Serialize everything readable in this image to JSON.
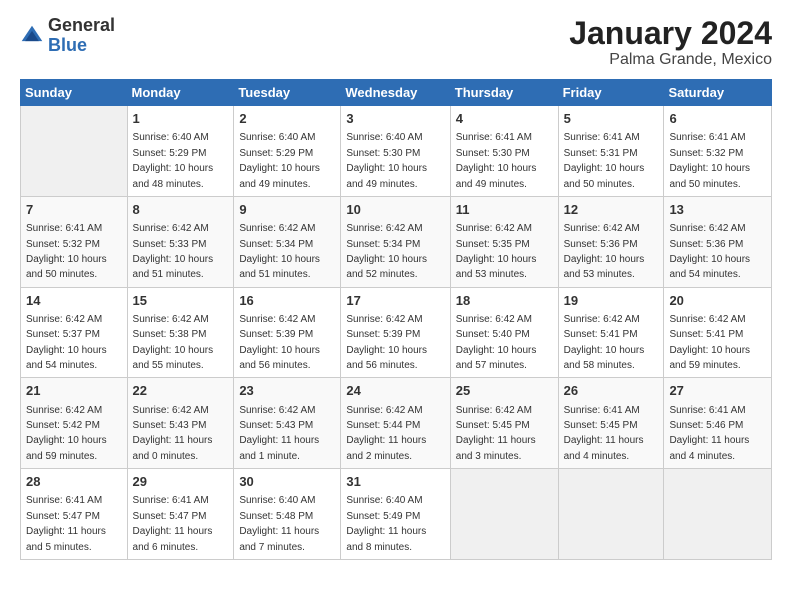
{
  "logo": {
    "general": "General",
    "blue": "Blue"
  },
  "header": {
    "month": "January 2024",
    "location": "Palma Grande, Mexico"
  },
  "columns": [
    "Sunday",
    "Monday",
    "Tuesday",
    "Wednesday",
    "Thursday",
    "Friday",
    "Saturday"
  ],
  "weeks": [
    [
      {
        "day": "",
        "info": ""
      },
      {
        "day": "1",
        "info": "Sunrise: 6:40 AM\nSunset: 5:29 PM\nDaylight: 10 hours\nand 48 minutes."
      },
      {
        "day": "2",
        "info": "Sunrise: 6:40 AM\nSunset: 5:29 PM\nDaylight: 10 hours\nand 49 minutes."
      },
      {
        "day": "3",
        "info": "Sunrise: 6:40 AM\nSunset: 5:30 PM\nDaylight: 10 hours\nand 49 minutes."
      },
      {
        "day": "4",
        "info": "Sunrise: 6:41 AM\nSunset: 5:30 PM\nDaylight: 10 hours\nand 49 minutes."
      },
      {
        "day": "5",
        "info": "Sunrise: 6:41 AM\nSunset: 5:31 PM\nDaylight: 10 hours\nand 50 minutes."
      },
      {
        "day": "6",
        "info": "Sunrise: 6:41 AM\nSunset: 5:32 PM\nDaylight: 10 hours\nand 50 minutes."
      }
    ],
    [
      {
        "day": "7",
        "info": "Sunrise: 6:41 AM\nSunset: 5:32 PM\nDaylight: 10 hours\nand 50 minutes."
      },
      {
        "day": "8",
        "info": "Sunrise: 6:42 AM\nSunset: 5:33 PM\nDaylight: 10 hours\nand 51 minutes."
      },
      {
        "day": "9",
        "info": "Sunrise: 6:42 AM\nSunset: 5:34 PM\nDaylight: 10 hours\nand 51 minutes."
      },
      {
        "day": "10",
        "info": "Sunrise: 6:42 AM\nSunset: 5:34 PM\nDaylight: 10 hours\nand 52 minutes."
      },
      {
        "day": "11",
        "info": "Sunrise: 6:42 AM\nSunset: 5:35 PM\nDaylight: 10 hours\nand 53 minutes."
      },
      {
        "day": "12",
        "info": "Sunrise: 6:42 AM\nSunset: 5:36 PM\nDaylight: 10 hours\nand 53 minutes."
      },
      {
        "day": "13",
        "info": "Sunrise: 6:42 AM\nSunset: 5:36 PM\nDaylight: 10 hours\nand 54 minutes."
      }
    ],
    [
      {
        "day": "14",
        "info": "Sunrise: 6:42 AM\nSunset: 5:37 PM\nDaylight: 10 hours\nand 54 minutes."
      },
      {
        "day": "15",
        "info": "Sunrise: 6:42 AM\nSunset: 5:38 PM\nDaylight: 10 hours\nand 55 minutes."
      },
      {
        "day": "16",
        "info": "Sunrise: 6:42 AM\nSunset: 5:39 PM\nDaylight: 10 hours\nand 56 minutes."
      },
      {
        "day": "17",
        "info": "Sunrise: 6:42 AM\nSunset: 5:39 PM\nDaylight: 10 hours\nand 56 minutes."
      },
      {
        "day": "18",
        "info": "Sunrise: 6:42 AM\nSunset: 5:40 PM\nDaylight: 10 hours\nand 57 minutes."
      },
      {
        "day": "19",
        "info": "Sunrise: 6:42 AM\nSunset: 5:41 PM\nDaylight: 10 hours\nand 58 minutes."
      },
      {
        "day": "20",
        "info": "Sunrise: 6:42 AM\nSunset: 5:41 PM\nDaylight: 10 hours\nand 59 minutes."
      }
    ],
    [
      {
        "day": "21",
        "info": "Sunrise: 6:42 AM\nSunset: 5:42 PM\nDaylight: 10 hours\nand 59 minutes."
      },
      {
        "day": "22",
        "info": "Sunrise: 6:42 AM\nSunset: 5:43 PM\nDaylight: 11 hours\nand 0 minutes."
      },
      {
        "day": "23",
        "info": "Sunrise: 6:42 AM\nSunset: 5:43 PM\nDaylight: 11 hours\nand 1 minute."
      },
      {
        "day": "24",
        "info": "Sunrise: 6:42 AM\nSunset: 5:44 PM\nDaylight: 11 hours\nand 2 minutes."
      },
      {
        "day": "25",
        "info": "Sunrise: 6:42 AM\nSunset: 5:45 PM\nDaylight: 11 hours\nand 3 minutes."
      },
      {
        "day": "26",
        "info": "Sunrise: 6:41 AM\nSunset: 5:45 PM\nDaylight: 11 hours\nand 4 minutes."
      },
      {
        "day": "27",
        "info": "Sunrise: 6:41 AM\nSunset: 5:46 PM\nDaylight: 11 hours\nand 4 minutes."
      }
    ],
    [
      {
        "day": "28",
        "info": "Sunrise: 6:41 AM\nSunset: 5:47 PM\nDaylight: 11 hours\nand 5 minutes."
      },
      {
        "day": "29",
        "info": "Sunrise: 6:41 AM\nSunset: 5:47 PM\nDaylight: 11 hours\nand 6 minutes."
      },
      {
        "day": "30",
        "info": "Sunrise: 6:40 AM\nSunset: 5:48 PM\nDaylight: 11 hours\nand 7 minutes."
      },
      {
        "day": "31",
        "info": "Sunrise: 6:40 AM\nSunset: 5:49 PM\nDaylight: 11 hours\nand 8 minutes."
      },
      {
        "day": "",
        "info": ""
      },
      {
        "day": "",
        "info": ""
      },
      {
        "day": "",
        "info": ""
      }
    ]
  ]
}
